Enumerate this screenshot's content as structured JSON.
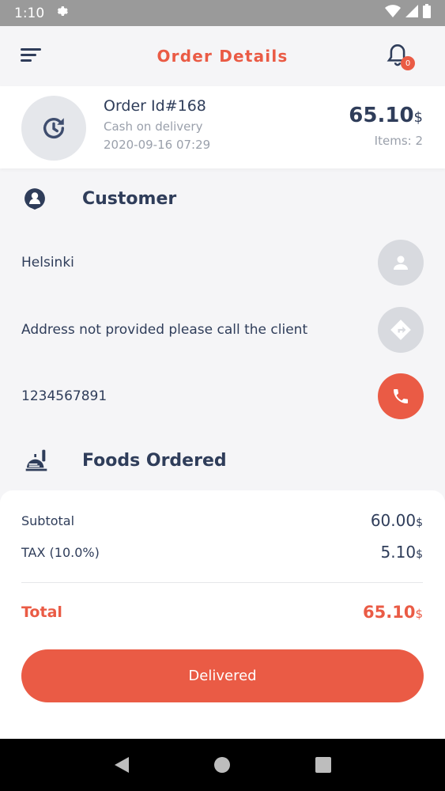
{
  "status": {
    "time": "1:10"
  },
  "header": {
    "title": "Order Details",
    "badge_count": "0"
  },
  "order": {
    "id_label": "Order Id#168",
    "payment": "Cash on delivery",
    "date": "2020-09-16 07:29",
    "price": "65.10",
    "currency": "$",
    "items": "Items: 2"
  },
  "customer": {
    "title": "Customer",
    "name": "Helsinki",
    "address": "Address not provided please call the client",
    "phone": "1234567891"
  },
  "foods": {
    "title": "Foods Ordered"
  },
  "summary": {
    "subtotal_label": "Subtotal",
    "subtotal_value": "60.00",
    "tax_label": "TAX (10.0%)",
    "tax_value": "5.10",
    "total_label": "Total",
    "total_value": "65.10",
    "currency": "$",
    "button_label": "Delivered"
  },
  "colors": {
    "accent": "#ea5b45",
    "text": "#2f3d5a",
    "muted": "#9aa0ab"
  }
}
